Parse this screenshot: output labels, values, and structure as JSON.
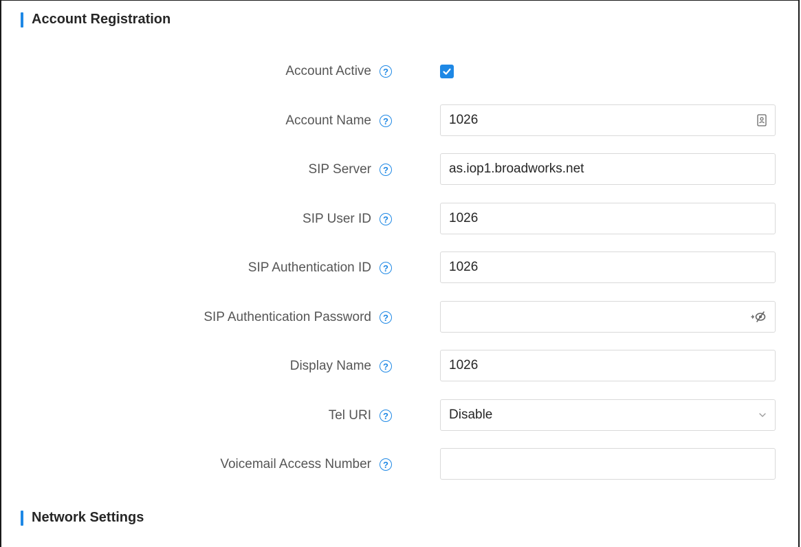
{
  "sections": {
    "account_registration": "Account Registration",
    "network_settings": "Network Settings"
  },
  "fields": {
    "account_active": {
      "label": "Account Active",
      "checked": true
    },
    "account_name": {
      "label": "Account Name",
      "value": "1026"
    },
    "sip_server": {
      "label": "SIP Server",
      "value": "as.iop1.broadworks.net"
    },
    "sip_user_id": {
      "label": "SIP User ID",
      "value": "1026"
    },
    "sip_auth_id": {
      "label": "SIP Authentication ID",
      "value": "1026"
    },
    "sip_auth_password": {
      "label": "SIP Authentication Password",
      "value": ""
    },
    "display_name": {
      "label": "Display Name",
      "value": "1026"
    },
    "tel_uri": {
      "label": "Tel URI",
      "value": "Disable"
    },
    "voicemail_access_number": {
      "label": "Voicemail Access Number",
      "value": ""
    }
  },
  "icons": {
    "help": "question-circle-icon",
    "checkbox": "checkmark-icon",
    "account_name_suffix": "contact-card-icon",
    "password_suffix": "eye-hidden-icon",
    "select_caret": "chevron-down-icon"
  },
  "colors": {
    "accent": "#1e88e5",
    "input_border": "#d9d9d9",
    "label_text": "#555555"
  }
}
